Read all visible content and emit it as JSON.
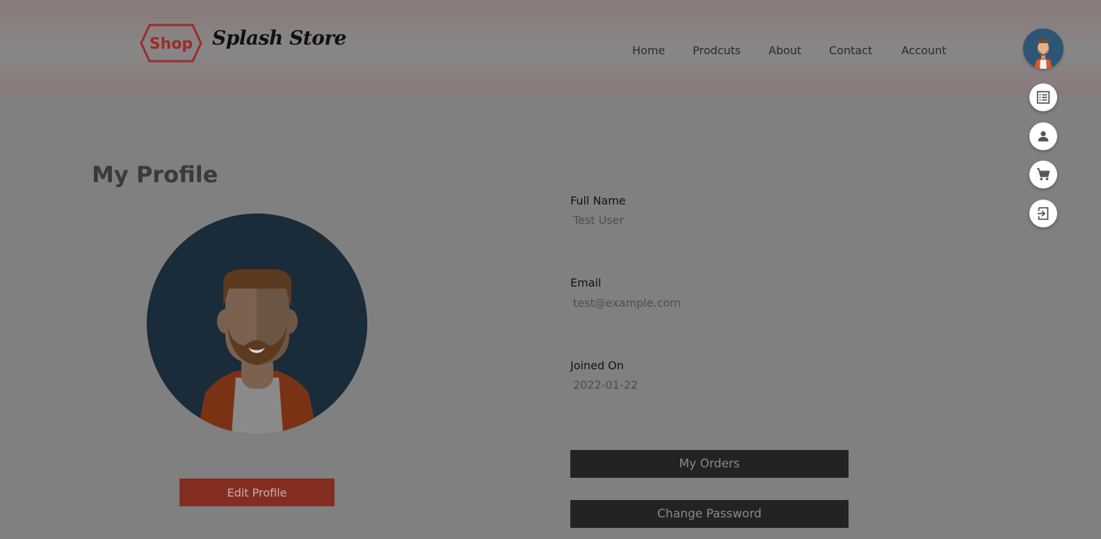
{
  "header": {
    "logo_text": "Shop",
    "brand_name": "Splash Store",
    "nav": [
      {
        "label": "Home",
        "icon": ""
      },
      {
        "label": "Prodcuts",
        "icon": ""
      },
      {
        "label": "About",
        "icon": ""
      },
      {
        "label": "Contact",
        "icon": ""
      },
      {
        "label": "Account",
        "icon": ""
      }
    ]
  },
  "floating_menu": {
    "items": [
      {
        "icon": "orders-list-icon"
      },
      {
        "icon": "person-icon"
      },
      {
        "icon": "cart-icon"
      },
      {
        "icon": "logout-icon"
      }
    ]
  },
  "profile": {
    "title": "My Profile",
    "edit_button": "Edit Profile",
    "fields": [
      {
        "label": "Full Name",
        "value": "Test User"
      },
      {
        "label": "Email",
        "value": "test@example.com"
      },
      {
        "label": "Joined On",
        "value": "2022-01-22"
      }
    ],
    "my_orders_button": "My Orders",
    "change_password_button": "Change Password"
  },
  "colors": {
    "logo_red": "#9e2a2a",
    "edit_button": "#842e22",
    "dark_button": "#232323",
    "avatar_bg": "#1a2b3a"
  }
}
